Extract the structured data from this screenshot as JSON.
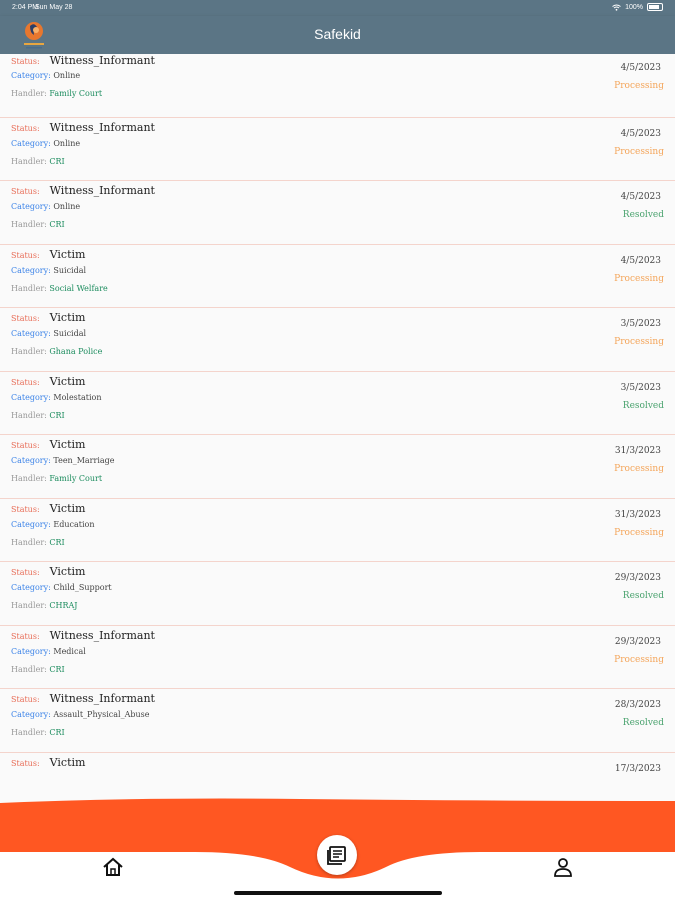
{
  "status_bar": {
    "time": "2:04 PM",
    "date": "Sun May 28",
    "battery": "100%"
  },
  "header": {
    "title": "Safekid"
  },
  "labels": {
    "status": "Status:",
    "category": "Category:",
    "handler": "Handler:"
  },
  "cases": [
    {
      "status": "Witness_Informant",
      "category": "Online",
      "handler": "Family Court",
      "date": "4/5/2023",
      "state": "Processing"
    },
    {
      "status": "Witness_Informant",
      "category": "Online",
      "handler": "CRI",
      "date": "4/5/2023",
      "state": "Processing"
    },
    {
      "status": "Witness_Informant",
      "category": "Online",
      "handler": "CRI",
      "date": "4/5/2023",
      "state": "Resolved"
    },
    {
      "status": "Victim",
      "category": "Suicidal",
      "handler": "Social Welfare",
      "date": "4/5/2023",
      "state": "Processing"
    },
    {
      "status": "Victim",
      "category": "Suicidal",
      "handler": "Ghana Police",
      "date": "3/5/2023",
      "state": "Processing"
    },
    {
      "status": "Victim",
      "category": "Molestation",
      "handler": "CRI",
      "date": "3/5/2023",
      "state": "Resolved"
    },
    {
      "status": "Victim",
      "category": "Teen_Marriage",
      "handler": "Family Court",
      "date": "31/3/2023",
      "state": "Processing"
    },
    {
      "status": "Victim",
      "category": "Education",
      "handler": "CRI",
      "date": "31/3/2023",
      "state": "Processing"
    },
    {
      "status": "Victim",
      "category": "Child_Support",
      "handler": "CHRAJ",
      "date": "29/3/2023",
      "state": "Resolved"
    },
    {
      "status": "Witness_Informant",
      "category": "Medical",
      "handler": "CRI",
      "date": "29/3/2023",
      "state": "Processing"
    },
    {
      "status": "Witness_Informant",
      "category": "Assault_Physical_Abuse",
      "handler": "CRI",
      "date": "28/3/2023",
      "state": "Resolved"
    },
    {
      "status": "Victim",
      "category": "",
      "handler": "",
      "date": "17/3/2023",
      "state": ""
    }
  ],
  "bottom_nav": {
    "items": [
      "home-icon",
      "reports-icon",
      "profile-icon"
    ],
    "accent_color": "#ff5722"
  },
  "colors": {
    "header_bg": "#5b7585",
    "status_label": "#e86c56",
    "category_label": "#3d84e8",
    "handler_value": "#1c8c5e",
    "processing": "#f4a55a",
    "resolved": "#4ba36f"
  }
}
